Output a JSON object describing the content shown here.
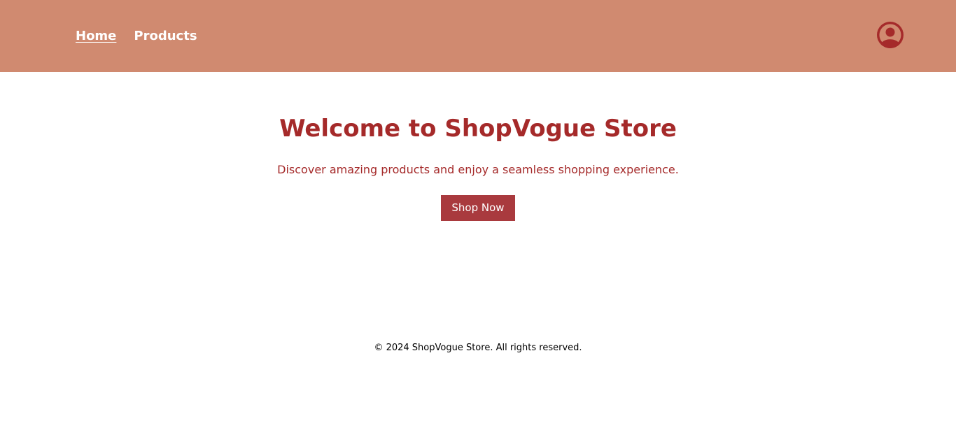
{
  "header": {
    "background": "#d08a70",
    "nav": [
      {
        "label": "Home",
        "active": true
      },
      {
        "label": "Products",
        "active": false
      }
    ],
    "avatar_icon": "user-circle-icon",
    "avatar_color": "#a52a2a"
  },
  "hero": {
    "title": "Welcome to ShopVogue Store",
    "subtitle": "Discover amazing products and enjoy a seamless shopping experience.",
    "cta_label": "Shop Now",
    "text_color": "#a52a2a",
    "button_color": "#a93a3e"
  },
  "footer": {
    "text": "© 2024 ShopVogue Store. All rights reserved."
  }
}
